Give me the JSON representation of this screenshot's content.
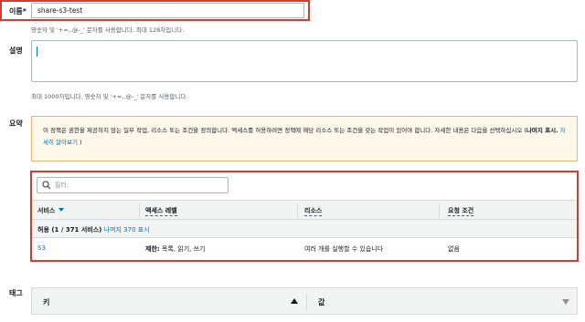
{
  "name_field": {
    "label": "이름*",
    "value": "share-s3-test",
    "hint": "영숫자 및 '+=,.@-_' 문자를 사용합니다. 최대 128자입니다."
  },
  "description_field": {
    "label": "설명",
    "value": "",
    "hint": "최대 1000자입니다. 영숫자 및 '+=,.@-_' 문자를 사용합니다."
  },
  "summary": {
    "label": "요약",
    "notice_text": "이 정책은 권한을 제공하지 않는 일부 작업, 리소스 또는 조건을 정의합니다. 액세스를 허용하려면 정책에 해당 리소스 또는 조건을 갖는 작업이 있어야 합니다. 자세한 내용은 다음을 선택하십시오 (",
    "notice_bold": "나머지 표시.",
    "notice_link": "자세히 알아보기",
    "notice_close": ")",
    "filter_placeholder": "필터:",
    "columns": [
      "서비스",
      "액세스 레벨",
      "리소스",
      "요청 조건"
    ],
    "group": {
      "label": "허용 (1 / 371 서비스)",
      "link": "나머지 370 표시"
    },
    "rows": [
      {
        "service": "S3",
        "access_bold": "제한:",
        "access": "목록, 읽기, 쓰기",
        "resource": "여러 개를 실행할 수 있습니다",
        "condition": "없음"
      }
    ]
  },
  "tags": {
    "label": "태그",
    "key_header": "키",
    "value_header": "값"
  },
  "colors": {
    "highlight": "#e0382b",
    "link": "#0073bb",
    "notice_bg": "#fef8ea",
    "notice_border": "#f2b36b"
  }
}
